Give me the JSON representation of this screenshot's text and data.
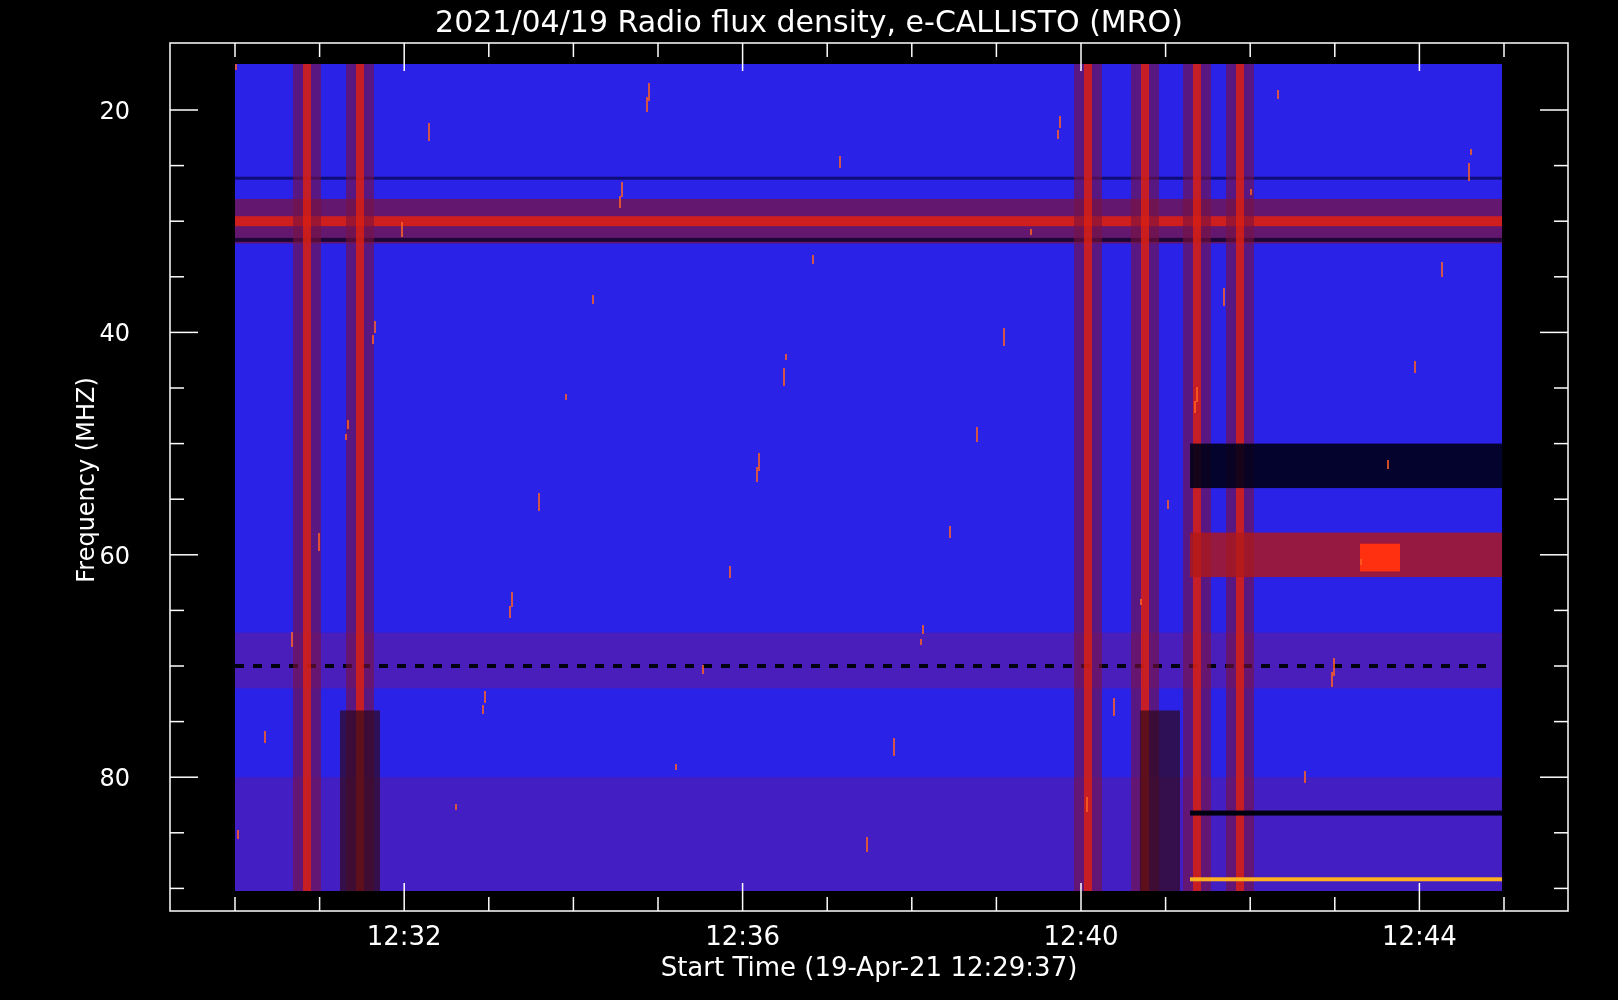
{
  "title": "2021/04/19  Radio flux density, e-CALLISTO (MRO)",
  "y_axis": {
    "label": "Frequency (MHZ)",
    "ticks": [
      "20",
      "40",
      "60",
      "80"
    ]
  },
  "x_axis": {
    "label": "Start Time (19-Apr-21 12:29:37)",
    "ticks": [
      "12:32",
      "12:36",
      "12:40",
      "12:44"
    ]
  }
}
